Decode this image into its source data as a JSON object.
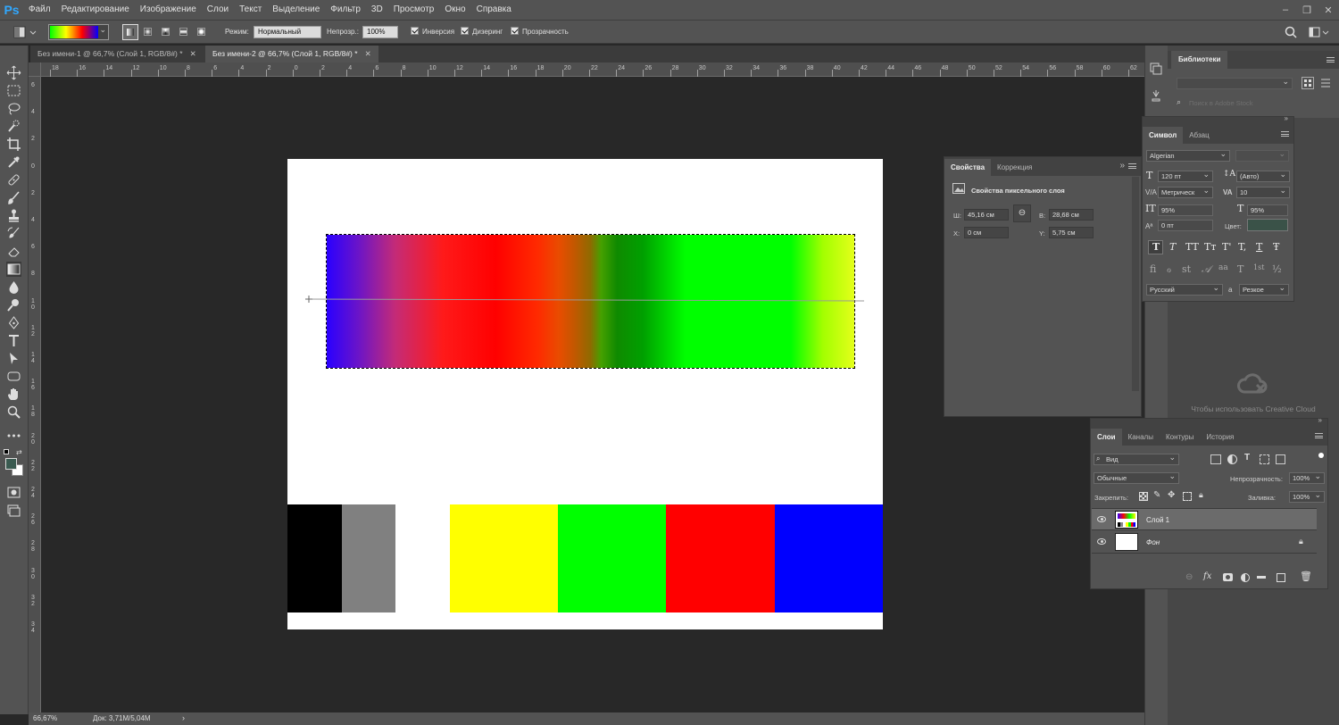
{
  "app": {
    "logo": "Ps"
  },
  "menu": [
    "Файл",
    "Редактирование",
    "Изображение",
    "Слои",
    "Текст",
    "Выделение",
    "Фильтр",
    "3D",
    "Просмотр",
    "Окно",
    "Справка"
  ],
  "options": {
    "mode_label": "Режим:",
    "mode_value": "Нормальный",
    "opacity_label": "Непрозр.:",
    "opacity_value": "100%",
    "inverse": "Инверсия",
    "dither": "Дизеринг",
    "transparency": "Прозрачность"
  },
  "tabs": [
    {
      "label": "Без имени-1 @ 66,7% (Слой 1, RGB/8#) *"
    },
    {
      "label": "Без имени-2 @ 66,7% (Слой 1, RGB/8#) *"
    }
  ],
  "rulers": {
    "h": [
      "18",
      "16",
      "14",
      "12",
      "10",
      "8",
      "6",
      "4",
      "2",
      "0",
      "2",
      "4",
      "6",
      "8",
      "10",
      "12",
      "14",
      "16",
      "18",
      "20",
      "22",
      "24",
      "26",
      "28",
      "30",
      "32",
      "34",
      "36",
      "38",
      "40",
      "42",
      "44",
      "46",
      "48",
      "50",
      "52",
      "54",
      "56",
      "58",
      "60",
      "62"
    ],
    "v": [
      "6",
      "4",
      "2",
      "0",
      "2",
      "4",
      "6",
      "8",
      "1 0",
      "1 2",
      "1 4",
      "1 6",
      "1 8",
      "2 0",
      "2 2",
      "2 4",
      "2 6",
      "2 8",
      "3 0",
      "3 2",
      "3 4"
    ]
  },
  "document": {
    "swatch_colors": [
      "#000000",
      "#808080",
      "#ffffff",
      "#ffff00",
      "#00ff00",
      "#ff0000",
      "#0000ff"
    ]
  },
  "status": {
    "zoom": "66,67%",
    "doc": "Док: 3,71M/5,04M"
  },
  "libraries": {
    "title": "Библиотеки",
    "search_placeholder": "Поиск в Adobe Stock",
    "cc_message": "Чтобы использовать Creative Cloud"
  },
  "properties": {
    "tabs": [
      "Свойства",
      "Коррекция"
    ],
    "header": "Свойства пиксельного слоя",
    "w_label": "Ш:",
    "w_value": "45,16 см",
    "h_label": "В:",
    "h_value": "28,68 см",
    "x_label": "X:",
    "x_value": "0 см",
    "y_label": "Y:",
    "y_value": "5,75 см"
  },
  "character": {
    "tabs": [
      "Символ",
      "Абзац"
    ],
    "font": "Algerian",
    "size": "120 пт",
    "leading": "(Авто)",
    "kerning": "Метрическ",
    "tracking": "10",
    "vscale": "95%",
    "hscale": "95%",
    "baseline": "0 пт",
    "color_label": "Цвет:",
    "language": "Русский",
    "aa_label": "a",
    "antialias": "Резкое",
    "style_glyphs": [
      "T",
      "T",
      "TT",
      "Tт",
      "T'",
      "T,",
      "T",
      "Ŧ"
    ],
    "ot_glyphs": [
      "fi",
      "ℴ",
      "st",
      "𝒜",
      "aa",
      "T",
      "1st",
      "½"
    ]
  },
  "layers": {
    "tabs": [
      "Слои",
      "Каналы",
      "Контуры",
      "История"
    ],
    "filter": "Вид",
    "blend": "Обычные",
    "opacity_label": "Непрозрачность:",
    "opacity_value": "100%",
    "lock_label": "Закрепить:",
    "fill_label": "Заливка:",
    "fill_value": "100%",
    "items": [
      {
        "name": "Слой 1"
      },
      {
        "name": "Фон"
      }
    ]
  }
}
